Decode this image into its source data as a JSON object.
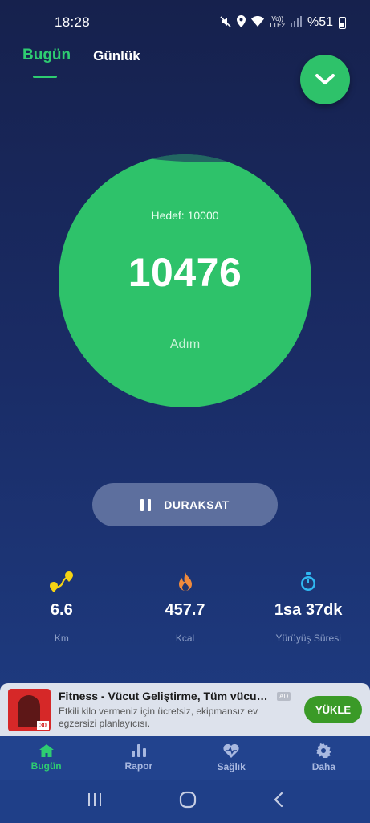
{
  "status": {
    "time": "18:28",
    "network": "LTE2",
    "volte": "Vo))",
    "battery": "%51"
  },
  "tabs": [
    {
      "label": "Bugün",
      "active": true
    },
    {
      "label": "Günlük",
      "active": false
    }
  ],
  "collapse_icon": "chevron-down-icon",
  "steps": {
    "goal": "Hedef: 10000",
    "count": "10476",
    "unit": "Adım"
  },
  "pause_button": {
    "label": "DURAKSAT"
  },
  "stats": [
    {
      "icon": "route-icon",
      "value": "6.6",
      "label": "Km",
      "color": "#f5d313"
    },
    {
      "icon": "flame-icon",
      "value": "457.7",
      "label": "Kcal",
      "color": "#f08a3c"
    },
    {
      "icon": "stopwatch-icon",
      "value": "1sa 37dk",
      "label": "Yürüyüş Süresi",
      "color": "#2fb8f2"
    }
  ],
  "ad": {
    "title": "Fitness - Vücut Geliştirme, Tüm vücut E...",
    "badge": "AD",
    "description": "Etkili kilo vermeniz için ücretsiz, ekipmansız ev egzersizi planlayıcısı.",
    "install_label": "YÜKLE",
    "thumb_number": "30"
  },
  "bottom_nav": [
    {
      "label": "Bugün",
      "icon": "home-icon",
      "active": true
    },
    {
      "label": "Rapor",
      "icon": "bar-chart-icon",
      "active": false
    },
    {
      "label": "Sağlık",
      "icon": "heart-pulse-icon",
      "active": false
    },
    {
      "label": "Daha",
      "icon": "gear-icon",
      "active": false
    }
  ],
  "colors": {
    "accent": "#2ec26a",
    "background_top": "#16214d",
    "background_bottom": "#1f3f88"
  }
}
